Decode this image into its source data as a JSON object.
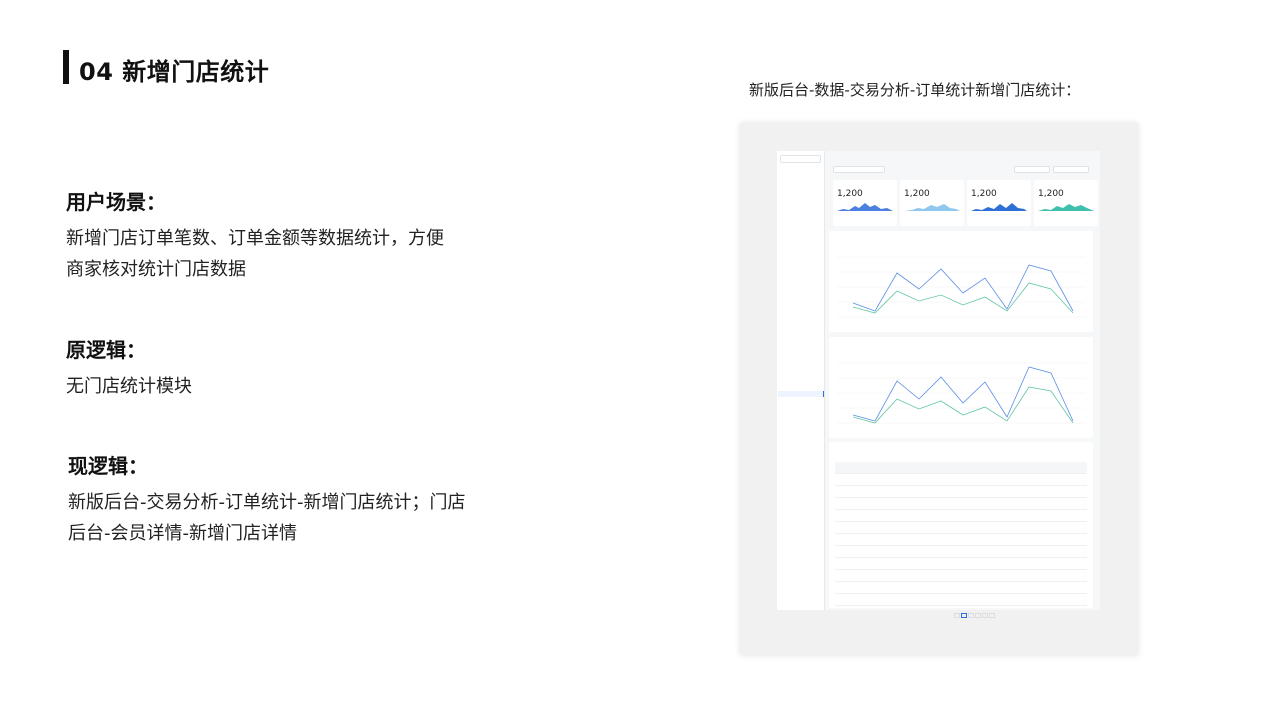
{
  "page": {
    "title": "04 新增门店统计"
  },
  "sections": {
    "scenario": {
      "heading": "用户场景：",
      "lines": [
        "新增门店订单笔数、订单金额等数据统计，方便",
        "商家核对统计门店数据"
      ]
    },
    "old_logic": {
      "heading": "原逻辑：",
      "lines": [
        "无门店统计模块"
      ]
    },
    "new_logic": {
      "heading": "现逻辑：",
      "lines": [
        "新版后台-交易分析-订单统计-新增门店统计；门店",
        "后台-会员详情-新增门店详情"
      ]
    }
  },
  "screenshot": {
    "caption": "新版后台-数据-交易分析-订单统计新增门店统计：",
    "kpis": [
      {
        "value": "1,200"
      },
      {
        "value": "1,200"
      },
      {
        "value": "1,200"
      },
      {
        "value": "1,200"
      }
    ]
  },
  "colors": {
    "accent": "#2d6fe0",
    "line_a": "#5b8ee6",
    "line_b": "#63c7a6",
    "text": "#111111"
  }
}
